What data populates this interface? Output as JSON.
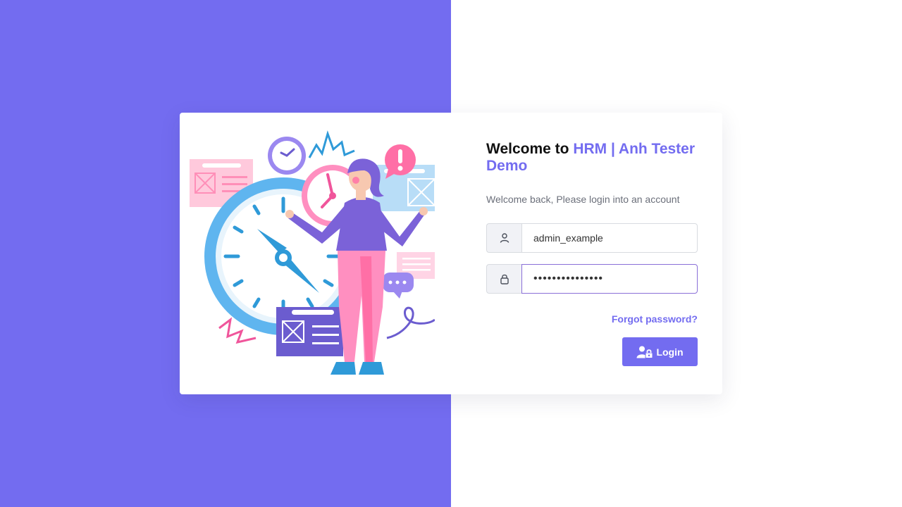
{
  "header": {
    "welcome_prefix": "Welcome to",
    "brand_name": "HRM | Anh Tester Demo",
    "subtitle": "Welcome back, Please login into an account"
  },
  "form": {
    "username_value": "admin_example",
    "password_value": "•••••••••••••••",
    "forgot_password_label": "Forgot password?",
    "login_label": "Login",
    "username_icon": "user-icon",
    "password_icon": "lock-icon",
    "login_icon": "user-lock-icon"
  },
  "colors": {
    "accent": "#736cf0",
    "left_panel": "#736cf0",
    "text_dark": "#111111",
    "text_muted": "#6b6f7a",
    "input_border": "#d8dbe0",
    "focused_border": "#8a6fd8"
  }
}
